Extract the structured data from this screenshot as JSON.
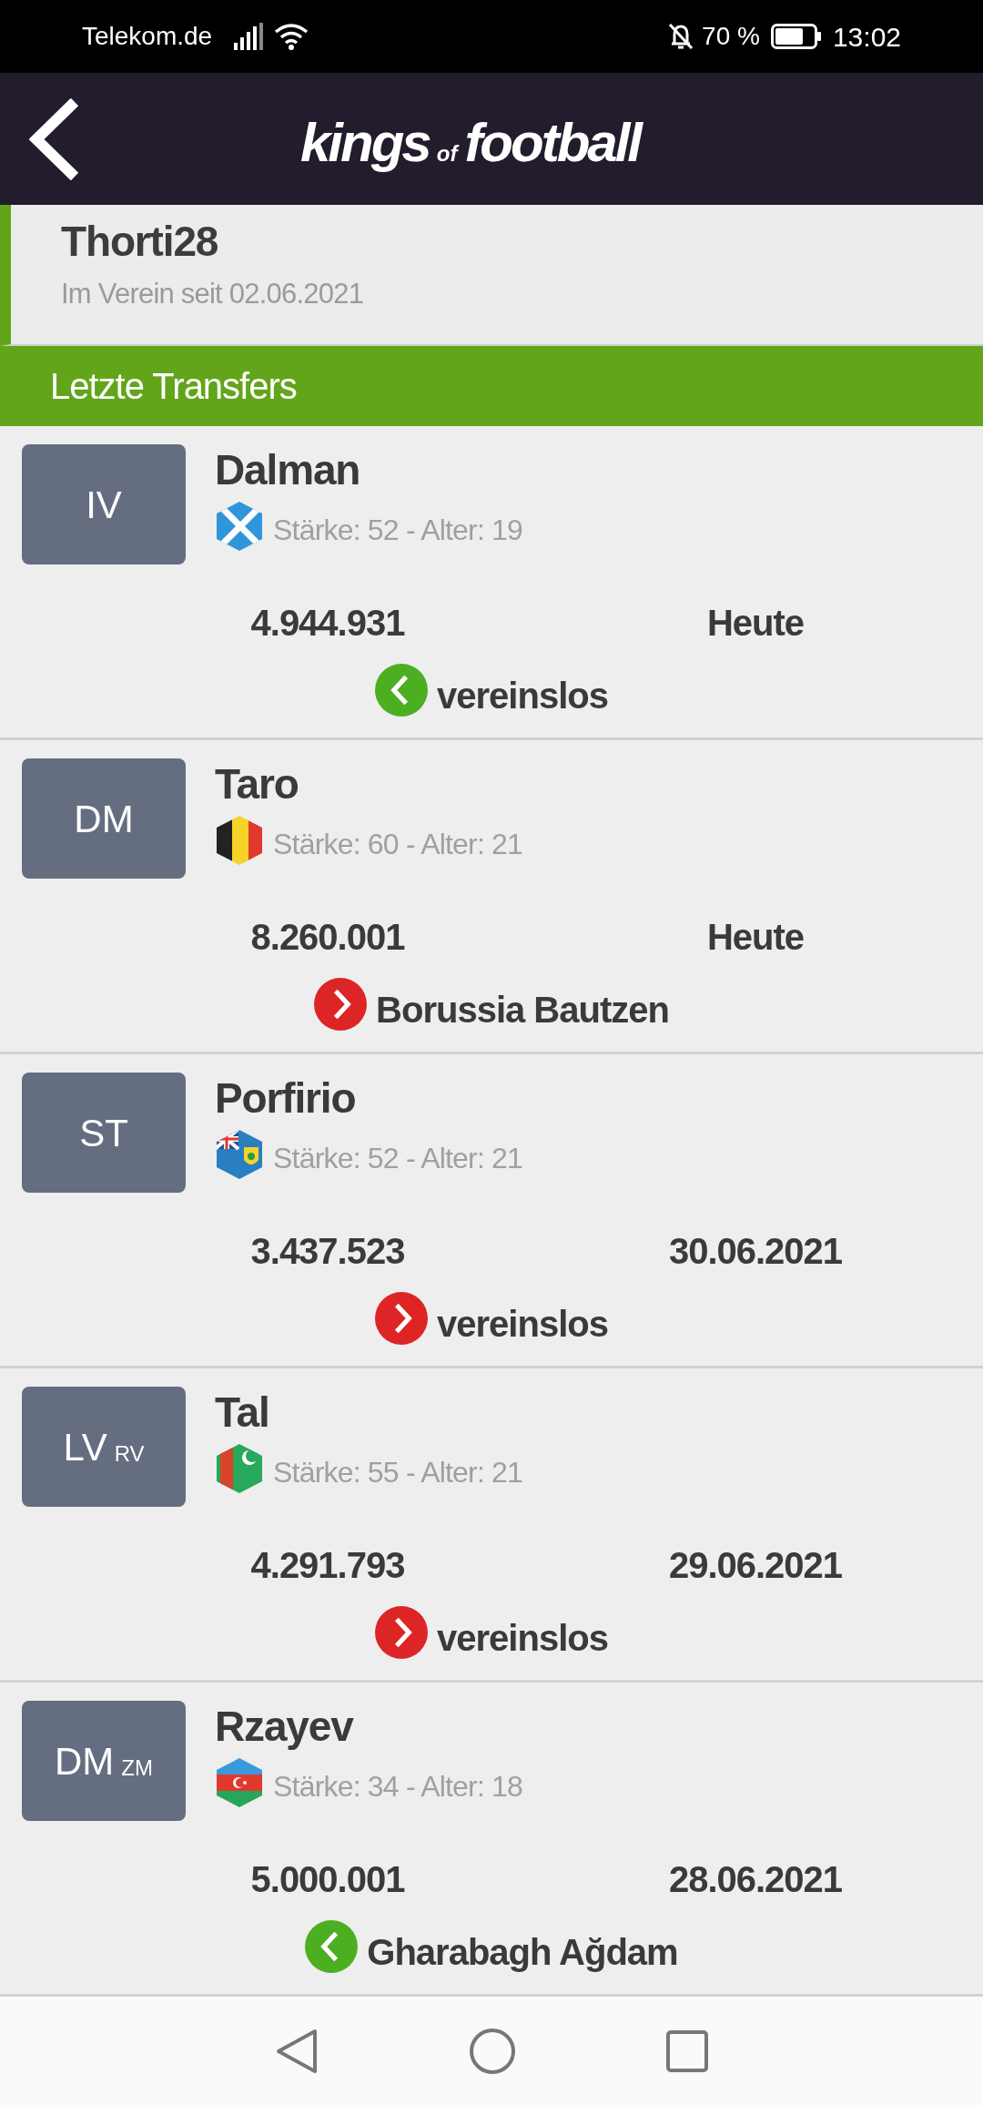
{
  "status_bar": {
    "carrier": "Telekom.de",
    "battery": "70 %",
    "time": "13:02"
  },
  "header": {
    "logo": [
      "kings",
      "of",
      "football"
    ]
  },
  "profile": {
    "name": "Thorti28",
    "since": "Im Verein seit 02.06.2021"
  },
  "section_title": "Letzte Transfers",
  "transfers": [
    {
      "position": "IV",
      "name": "Dalman",
      "flag": {
        "kind": "scotland"
      },
      "stats": "Stärke: 52 - Alter: 19",
      "amount": "4.944.931",
      "date": "Heute",
      "kind": "in",
      "club": "vereinslos"
    },
    {
      "position": "DM",
      "name": "Taro",
      "flag": {
        "kind": "belgium"
      },
      "stats": "Stärke: 60 - Alter: 21",
      "amount": "8.260.001",
      "date": "Heute",
      "kind": "out",
      "club": "Borussia Bautzen"
    },
    {
      "position": "ST",
      "name": "Porfirio",
      "flag": {
        "kind": "turks_caicos"
      },
      "stats": "Stärke: 52 - Alter: 21",
      "amount": "3.437.523",
      "date": "30.06.2021",
      "kind": "out",
      "club": "vereinslos"
    },
    {
      "position": "LV",
      "position_secondary": "RV",
      "name": "Tal",
      "flag": {
        "kind": "turkmenistan"
      },
      "stats": "Stärke: 55 - Alter: 21",
      "amount": "4.291.793",
      "date": "29.06.2021",
      "kind": "out",
      "club": "vereinslos"
    },
    {
      "position": "DM",
      "position_secondary": "ZM",
      "name": "Rzayev",
      "flag": {
        "kind": "azerbaijan"
      },
      "stats": "Stärke: 34 - Alter: 18",
      "amount": "5.000.001",
      "date": "28.06.2021",
      "kind": "in",
      "club": "Gharabagh Ağdam"
    }
  ]
}
